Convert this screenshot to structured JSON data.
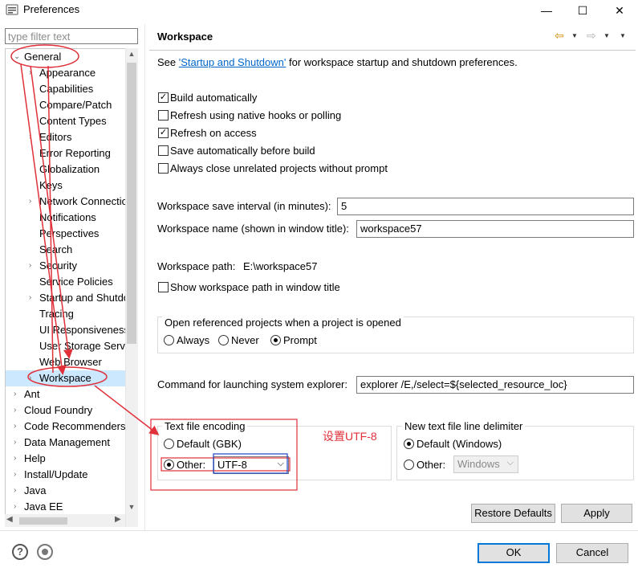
{
  "window": {
    "title": "Preferences",
    "minimize": "—",
    "maximize": "☐",
    "close": "✕"
  },
  "filter": {
    "placeholder": "type filter text"
  },
  "tree": {
    "general": "General",
    "children": [
      "Appearance",
      "Capabilities",
      "Compare/Patch",
      "Content Types",
      "Editors",
      "Error Reporting",
      "Globalization",
      "Keys",
      "Network Connectio",
      "Notifications",
      "Perspectives",
      "Search",
      "Security",
      "Service Policies",
      "Startup and Shutdo",
      "Tracing",
      "UI Responsiveness",
      "User Storage Servi",
      "Web Browser",
      "Workspace"
    ],
    "roots": [
      "Ant",
      "Cloud Foundry",
      "Code Recommenders",
      "Data Management",
      "Help",
      "Install/Update",
      "Java",
      "Java EE"
    ]
  },
  "page": {
    "title": "Workspace",
    "intro_prefix": "See ",
    "intro_link": "'Startup and Shutdown'",
    "intro_suffix": " for workspace startup and shutdown preferences.",
    "checkboxes": [
      {
        "label": "Build automatically",
        "checked": true
      },
      {
        "label": "Refresh using native hooks or polling",
        "checked": false
      },
      {
        "label": "Refresh on access",
        "checked": true
      },
      {
        "label": "Save automatically before build",
        "checked": false
      },
      {
        "label": "Always close unrelated projects without prompt",
        "checked": false
      }
    ],
    "save_interval_label": "Workspace save interval (in minutes):",
    "save_interval_value": "5",
    "name_label": "Workspace name (shown in window title):",
    "name_value": "workspace57",
    "path_label": "Workspace path:",
    "path_value": "E:\\workspace57",
    "show_path_label": "Show workspace path in window title",
    "open_ref_label": "Open referenced projects when a project is opened",
    "open_ref_options": [
      "Always",
      "Never",
      "Prompt"
    ],
    "open_ref_selected": "Prompt",
    "cmd_label": "Command for launching system explorer:",
    "cmd_value": "explorer /E,/select=${selected_resource_loc}",
    "encoding": {
      "title": "Text file encoding",
      "default_label": "Default (GBK)",
      "other_label": "Other:",
      "other_value": "UTF-8",
      "selected": "Other"
    },
    "annotation": "设置UTF-8",
    "delimiter": {
      "title": "New text file line delimiter",
      "default_label": "Default (Windows)",
      "other_label": "Other:",
      "other_value": "Windows",
      "selected": "Default"
    },
    "restore_defaults": "Restore Defaults",
    "apply": "Apply"
  },
  "footer": {
    "ok": "OK",
    "cancel": "Cancel"
  },
  "colors": {
    "annotation": "#e0303a",
    "highlight_box": "#1a44c8",
    "link": "#0066cc"
  }
}
